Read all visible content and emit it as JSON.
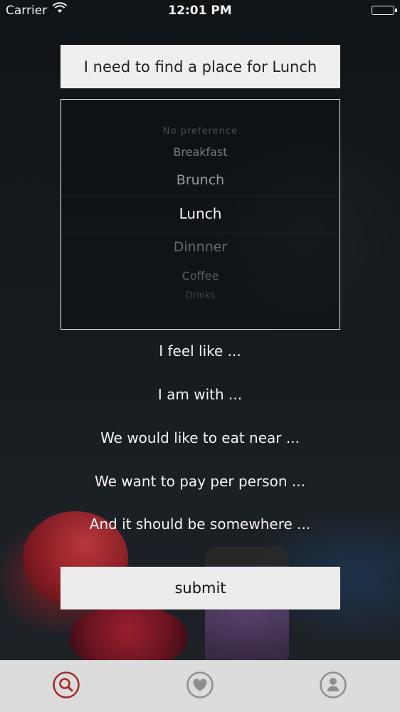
{
  "status_bar": {
    "carrier": "Carrier",
    "time": "12:01 PM",
    "wifi_icon": "wifi-icon",
    "battery_icon": "battery-icon"
  },
  "header": {
    "title": "I need to find a place for Lunch"
  },
  "meal_picker": {
    "options": [
      "No preference",
      "Breakfast",
      "Brunch",
      "Lunch",
      "Dinnner",
      "Coffee",
      "Drinks"
    ],
    "selected": "Lunch"
  },
  "prompts": {
    "feel_like": "I feel like ...",
    "with": "I am with ...",
    "near": "We would like to eat near ...",
    "pay": "We want to pay per person ...",
    "somewhere": "And it should be somewhere ..."
  },
  "actions": {
    "submit_label": "submit"
  },
  "tab_bar": {
    "tabs": [
      {
        "icon": "search-icon",
        "active": true
      },
      {
        "icon": "heart-icon",
        "active": false
      },
      {
        "icon": "profile-icon",
        "active": false
      }
    ],
    "active_color": "#a32a2a",
    "inactive_color": "#8e8e8e"
  }
}
